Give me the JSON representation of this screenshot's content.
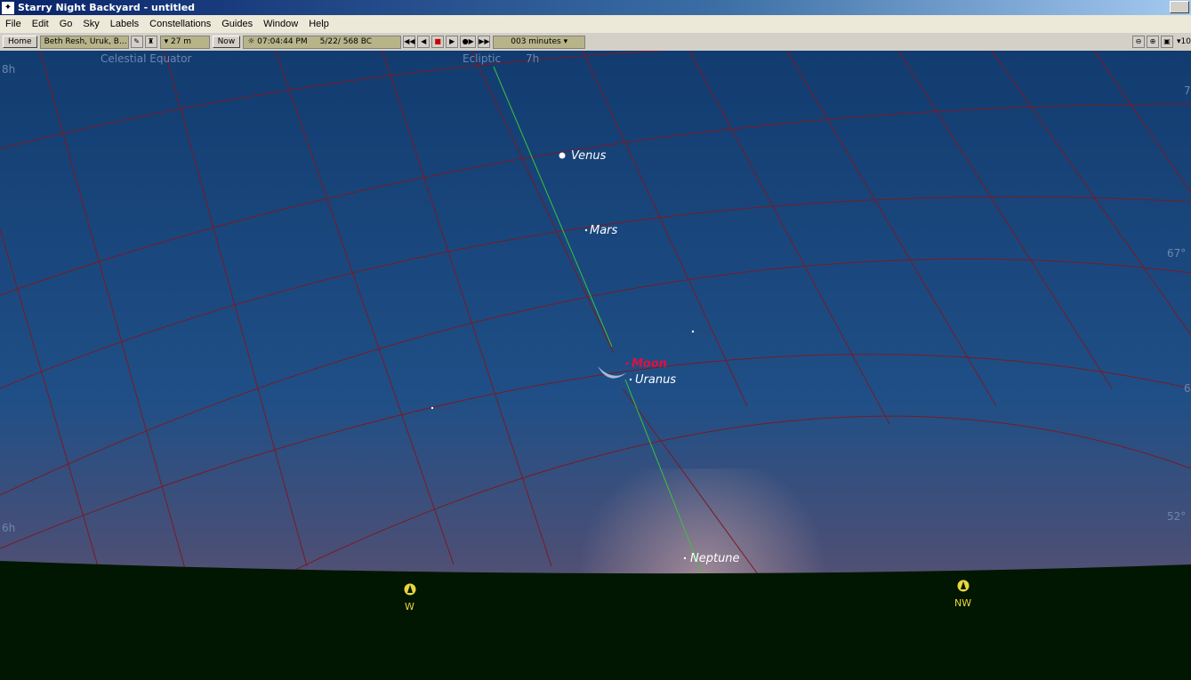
{
  "window": {
    "title": "Starry Night Backyard - untitled"
  },
  "menu": {
    "items": [
      "File",
      "Edit",
      "Go",
      "Sky",
      "Labels",
      "Constellations",
      "Guides",
      "Window",
      "Help"
    ]
  },
  "toolbar": {
    "home_label": "Home",
    "location": "Beth Resh, Uruk, B...",
    "elevation": "27 m",
    "now_label": "Now",
    "time": "07:04:44 PM",
    "date": "5/22/  568 BC",
    "time_step": "003 minutes",
    "zoom_partial": "10"
  },
  "sky": {
    "grid_labels": {
      "celestial_equator": "Celestial Equator",
      "ecliptic": "Ecliptic",
      "ra_7h": "7h",
      "ra_8h": "8h",
      "ra_6h": "6h",
      "ra_7_edge": "7",
      "dec_67": "67°",
      "dec_6_edge": "6",
      "dec_52": "52°"
    },
    "planets": {
      "venus": "Venus",
      "mars": "Mars",
      "moon": "Moon",
      "uranus": "Uranus",
      "neptune": "Neptune"
    },
    "compass": {
      "west": "W",
      "northwest": "NW"
    }
  },
  "colors": {
    "sky_top": "#123c70",
    "sky_mid": "#1f4f86",
    "horizon_glow": "#7a5a6a",
    "ground": "#021702",
    "grid_line": "#7a1a24",
    "ecliptic_line": "#3cc23c",
    "compass": "#e8d63c"
  }
}
